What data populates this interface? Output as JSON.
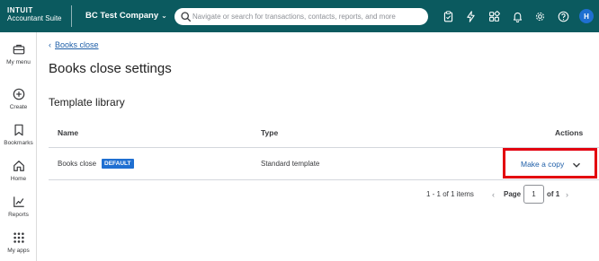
{
  "topbar": {
    "brand_line1": "INTUIT",
    "brand_line2": "Accountant Suite",
    "company_name": "BC Test Company",
    "search_placeholder": "Navigate or search for transactions, contacts, reports, and more",
    "avatar_initial": "H",
    "icons": [
      "clipboard-icon",
      "lightning-icon",
      "apps-icon",
      "bell-icon",
      "gear-icon",
      "help-icon"
    ],
    "bg_color": "#0b5a5f"
  },
  "sidebar": {
    "items": [
      {
        "label": "My menu",
        "icon": "briefcase-icon"
      },
      {
        "label": "Create",
        "icon": "plus-circle-icon"
      },
      {
        "label": "Bookmarks",
        "icon": "bookmark-icon"
      },
      {
        "label": "Home",
        "icon": "home-icon"
      },
      {
        "label": "Reports",
        "icon": "chart-icon"
      },
      {
        "label": "My apps",
        "icon": "grid-icon"
      }
    ]
  },
  "main": {
    "back_link": "Books close",
    "page_title": "Books close settings",
    "section_title": "Template library",
    "table": {
      "columns": [
        "Name",
        "Type",
        "Actions"
      ],
      "rows": [
        {
          "name": "Books close",
          "badge": "DEFAULT",
          "type": "Standard template",
          "action": "Make a copy"
        }
      ]
    },
    "pagination": {
      "summary": "1 - 1 of 1 items",
      "page_label": "Page",
      "page_value": "1",
      "of_label": "of 1"
    }
  },
  "colors": {
    "link": "#1f5fa8",
    "badge": "#1f6fd1",
    "highlight": "#e3000f"
  }
}
